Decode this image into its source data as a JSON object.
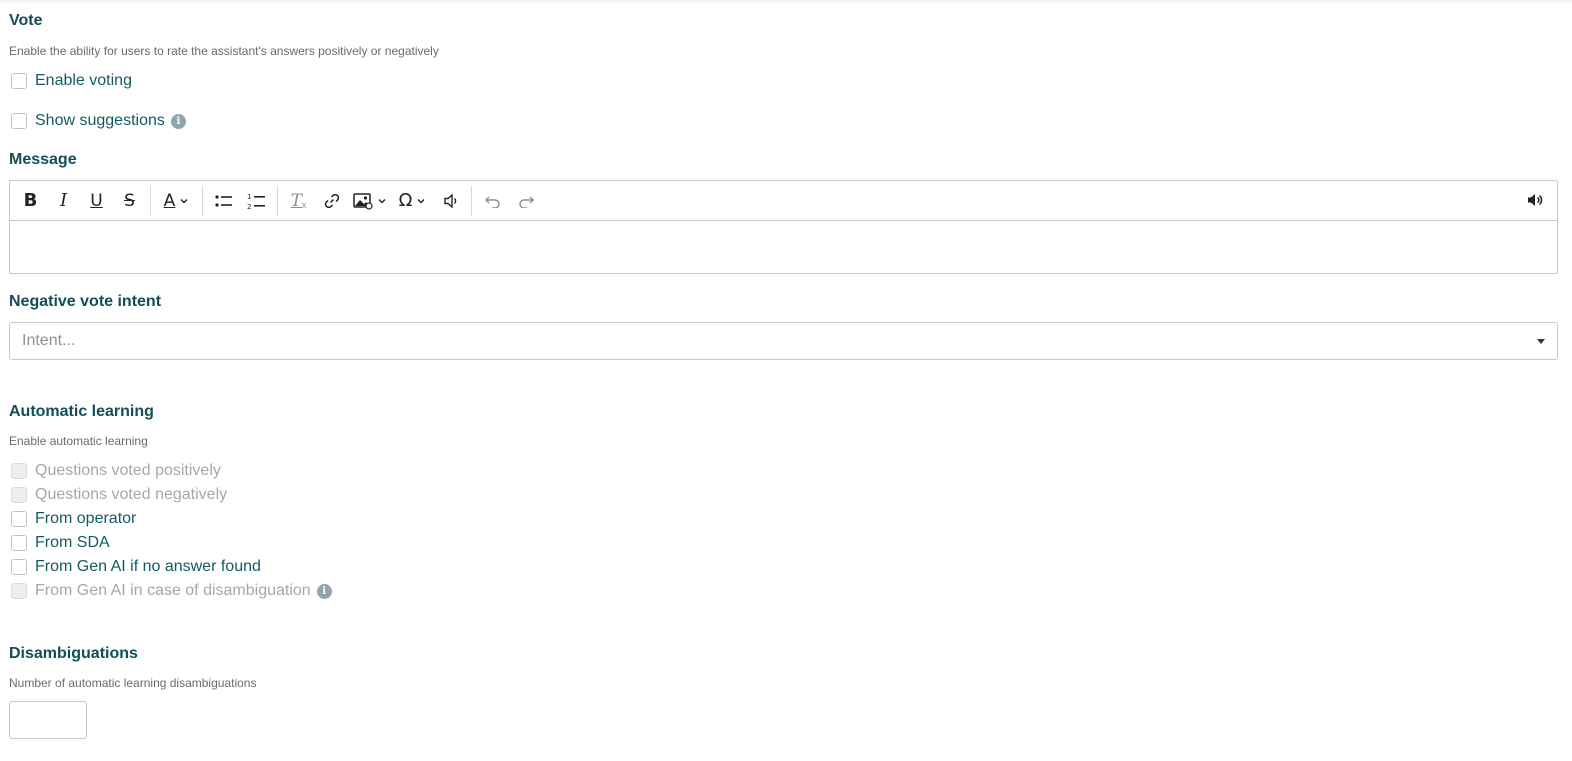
{
  "vote": {
    "title": "Vote",
    "description": "Enable the ability for users to rate the assistant's answers positively or negatively",
    "enable_voting_label": "Enable voting",
    "show_suggestions_label": "Show suggestions"
  },
  "message": {
    "title": "Message",
    "toolbar": {
      "bold": "B",
      "italic": "I",
      "underline": "U",
      "strikethrough": "S",
      "font_color": "A",
      "special_char": "Ω",
      "clear_format": "T"
    }
  },
  "negative_vote_intent": {
    "title": "Negative vote intent",
    "placeholder": "Intent..."
  },
  "automatic_learning": {
    "title": "Automatic learning",
    "description": "Enable automatic learning",
    "options": [
      {
        "label": "Questions voted positively",
        "disabled": true
      },
      {
        "label": "Questions voted negatively",
        "disabled": true
      },
      {
        "label": "From operator",
        "disabled": false
      },
      {
        "label": "From SDA",
        "disabled": false
      },
      {
        "label": "From Gen AI if no answer found",
        "disabled": false
      },
      {
        "label": "From Gen AI in case of disambiguation",
        "disabled": true
      }
    ]
  },
  "disambiguations": {
    "title": "Disambiguations",
    "description": "Number of automatic learning disambiguations",
    "value": ""
  },
  "colors": {
    "heading": "#124e57",
    "label": "#145a60",
    "disabled_label": "#a3a8aa",
    "border": "#c6cacc"
  }
}
